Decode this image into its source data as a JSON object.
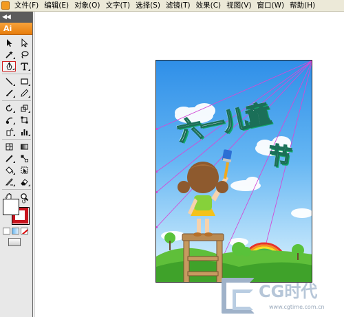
{
  "menu": {
    "items": [
      "文件(F)",
      "编辑(E)",
      "对象(O)",
      "文字(T)",
      "选择(S)",
      "滤镜(T)",
      "效果(C)",
      "视图(V)",
      "窗口(W)",
      "帮助(H)"
    ]
  },
  "toolbox": {
    "collapse_glyph": "◀◀",
    "logo_text": "Ai",
    "tools": [
      "selection-tool-icon",
      "direct-selection-tool-icon",
      "magic-wand-tool-icon",
      "lasso-tool-icon",
      "pen-tool-icon",
      "type-tool-icon",
      "line-segment-tool-icon",
      "rectangle-tool-icon",
      "paintbrush-tool-icon",
      "pencil-tool-icon",
      "rotate-tool-icon",
      "scale-tool-icon",
      "warp-tool-icon",
      "free-transform-tool-icon",
      "symbol-sprayer-tool-icon",
      "column-graph-tool-icon",
      "mesh-tool-icon",
      "gradient-tool-icon",
      "eyedropper-tool-icon",
      "blend-tool-icon",
      "live-paint-bucket-tool-icon",
      "live-paint-selection-tool-icon",
      "slice-tool-icon",
      "eraser-tool-icon",
      "hand-tool-icon",
      "zoom-tool-icon"
    ],
    "active_tool": "pen-tool-icon",
    "fill_color": "#ffffff",
    "stroke_color": "#c8141e"
  },
  "artwork": {
    "title_line1": "六一儿童",
    "title_line2": "节",
    "guide_color": "#d24bd6"
  },
  "watermark": {
    "title": "CG时代",
    "url": "www.cgtime.com.cn"
  }
}
